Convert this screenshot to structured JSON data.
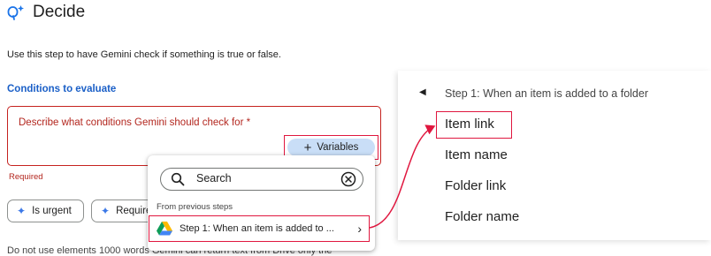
{
  "header": {
    "title": "Decide",
    "icon": "gemini-step-icon"
  },
  "description": "Use this step to have Gemini check if something is true or false.",
  "conditions": {
    "section_label": "Conditions to evaluate",
    "placeholder": "Describe what conditions Gemini should check for *",
    "required_text": "Required",
    "variables_label": "Variables"
  },
  "chips": [
    {
      "label": "Is urgent",
      "icon": "sparkle-icon"
    },
    {
      "label": "Require",
      "icon": "sparkle-icon"
    }
  ],
  "bottom_text": "Do not use elements 1000 words Gemini can return text from Drive only the",
  "dropdown": {
    "search_placeholder": "Search",
    "section_label": "From previous steps",
    "step_item": "Step 1: When an item is added to ...",
    "step_icon": "google-drive-icon"
  },
  "zoom_panel": {
    "title": "Step 1: When an item is added to a folder",
    "items": [
      "Item link",
      "Item name",
      "Folder link",
      "Folder name"
    ]
  },
  "colors": {
    "accent_blue": "#1a5fc7",
    "error_red": "#b3261e",
    "highlight_red": "#e0173f",
    "variables_bg": "#c9def7"
  }
}
